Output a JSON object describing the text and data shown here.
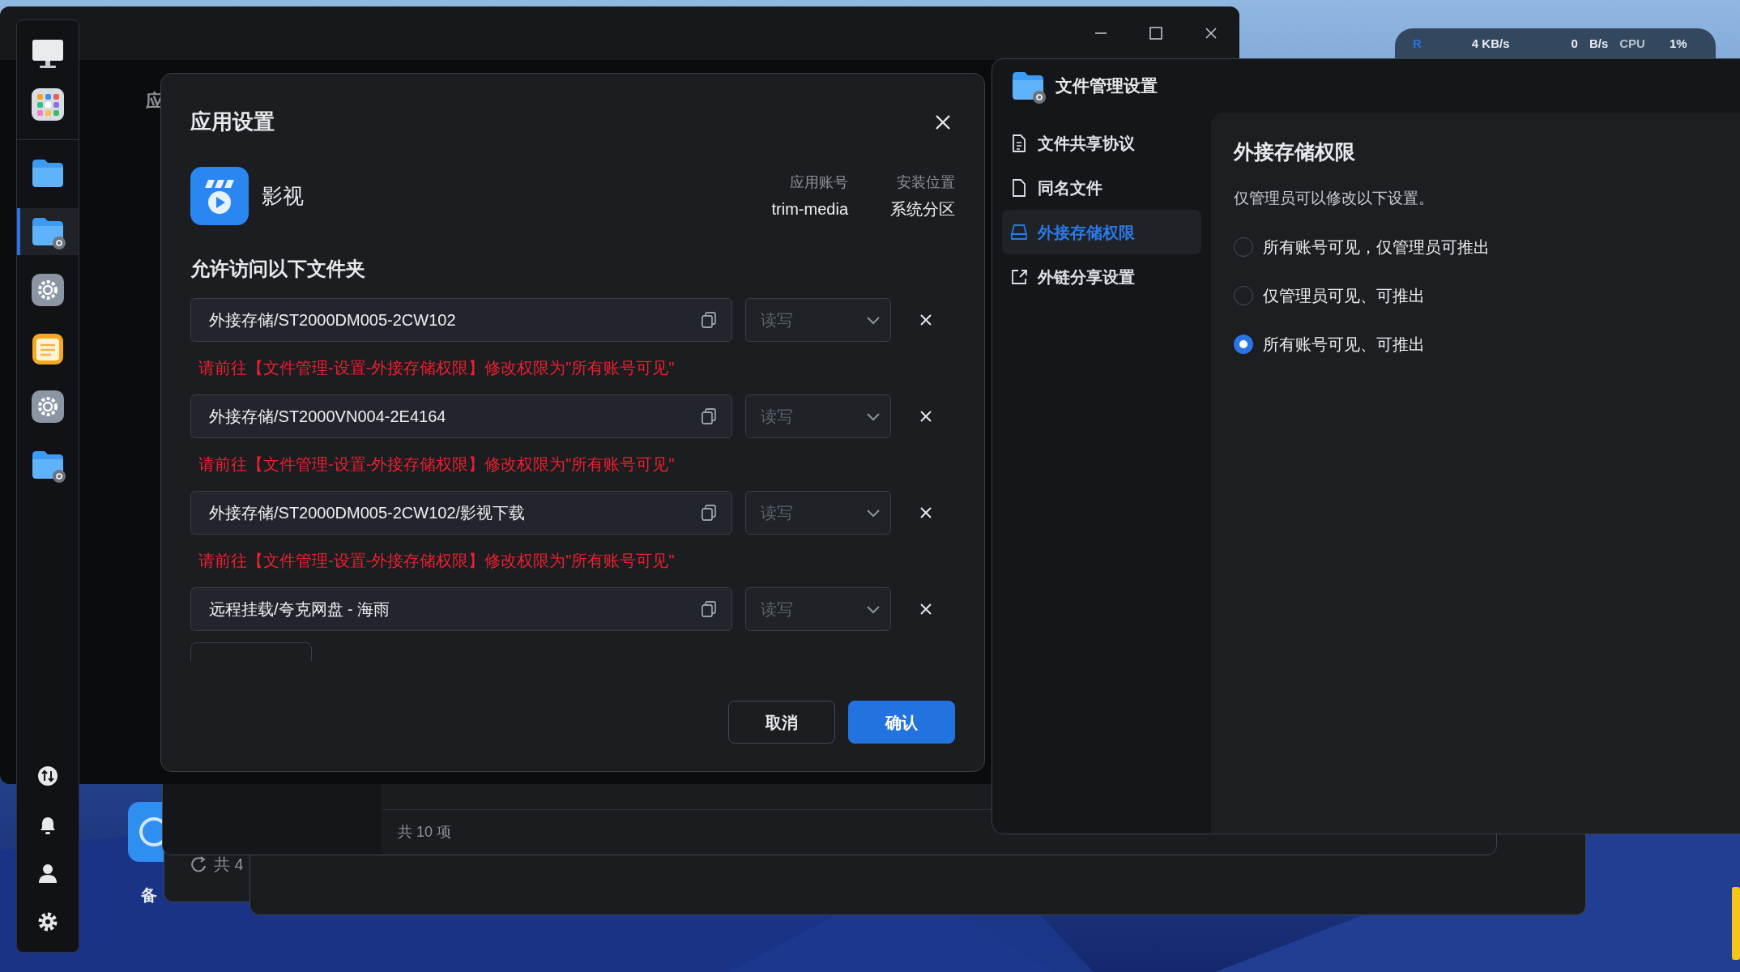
{
  "system_monitor": {
    "read_label": "R",
    "read_speed": "4 KB/s",
    "upload_value": "0",
    "upload_unit": "B/s",
    "cpu_label": "CPU",
    "cpu_value": "1%"
  },
  "background_window": {
    "heading_fragment": "应"
  },
  "dock": {
    "apps": [
      {
        "kind": "monitor",
        "selected": false
      },
      {
        "kind": "apps",
        "selected": false
      },
      {
        "kind": "folder",
        "selected": false
      },
      {
        "kind": "folder-gear",
        "selected": true
      },
      {
        "kind": "gear",
        "selected": false
      },
      {
        "kind": "notes",
        "selected": false
      },
      {
        "kind": "gear",
        "selected": false
      },
      {
        "kind": "folder-gear",
        "selected": false
      }
    ],
    "tools": [
      {
        "kind": "transfer"
      },
      {
        "kind": "bell"
      },
      {
        "kind": "user"
      },
      {
        "kind": "settings"
      }
    ]
  },
  "desktop_icon": {
    "label": "备"
  },
  "back_windows": [
    {
      "status": "共 4"
    },
    {
      "status": "共 10 项"
    }
  ],
  "app_settings_dialog": {
    "title": "应用设置",
    "app_name": "影视",
    "meta": [
      {
        "label": "应用账号",
        "value": "trim-media"
      },
      {
        "label": "安装位置",
        "value": "系统分区"
      }
    ],
    "section_title": "允许访问以下文件夹",
    "folders": [
      {
        "path": "外接存储/ST2000DM005-2CW102",
        "permission": "读写",
        "disabled": true,
        "warning": "请前往【文件管理-设置-外接存储权限】修改权限为\"所有账号可见\""
      },
      {
        "path": "外接存储/ST2000VN004-2E4164",
        "permission": "读写",
        "disabled": true,
        "warning": "请前往【文件管理-设置-外接存储权限】修改权限为\"所有账号可见\""
      },
      {
        "path": "外接存储/ST2000DM005-2CW102/影视下载",
        "permission": "读写",
        "disabled": true,
        "warning": "请前往【文件管理-设置-外接存储权限】修改权限为\"所有账号可见\""
      },
      {
        "path": "远程挂载/夸克网盘 - 海雨",
        "permission": "读写",
        "disabled": true
      }
    ],
    "buttons": [
      {
        "label": "取消",
        "kind": "secondary"
      },
      {
        "label": "确认",
        "kind": "primary"
      }
    ]
  },
  "file_settings_window": {
    "title": "文件管理设置",
    "sidebar": [
      {
        "label": "文件共享协议",
        "kind": "doc",
        "selected": false
      },
      {
        "label": "同名文件",
        "kind": "file",
        "selected": false
      },
      {
        "label": "外接存储权限",
        "kind": "drive",
        "selected": true
      },
      {
        "label": "外链分享设置",
        "kind": "share",
        "selected": false
      }
    ],
    "heading": "外接存储权限",
    "description": "仅管理员可以修改以下设置。",
    "options": [
      {
        "label": "所有账号可见，仅管理员可推出",
        "selected": false
      },
      {
        "label": "仅管理员可见、可推出",
        "selected": false
      },
      {
        "label": "所有账号可见、可推出",
        "selected": true
      }
    ]
  }
}
